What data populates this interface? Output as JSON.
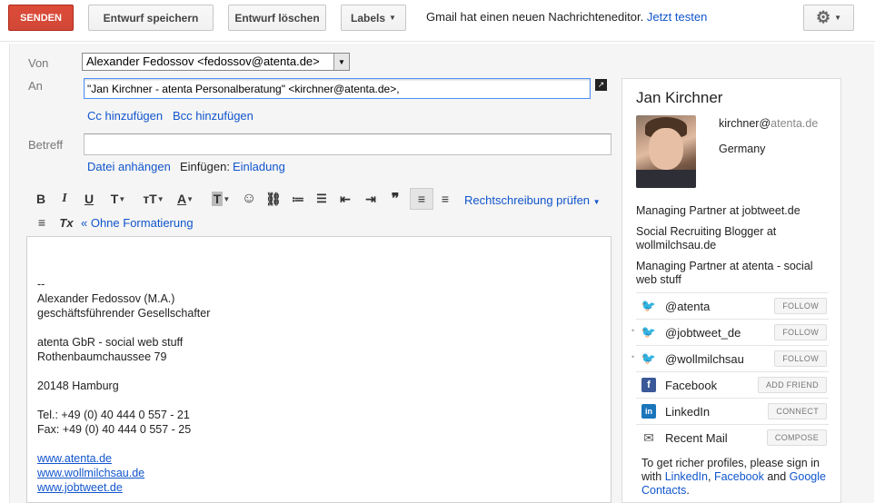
{
  "toolbar": {
    "send": "SENDEN",
    "save_draft": "Entwurf speichern",
    "delete_draft": "Entwurf löschen",
    "labels": "Labels",
    "notice_text": "Gmail hat einen neuen Nachrichteneditor.",
    "notice_link": "Jetzt testen"
  },
  "fields": {
    "from_label": "Von",
    "from_value": "Alexander Fedossov <fedossov@atenta.de>",
    "to_label": "An",
    "to_value": "\"Jan Kirchner - atenta Personalberatung\" <kirchner@atenta.de>,",
    "cc": "Cc hinzufügen",
    "bcc": "Bcc hinzufügen",
    "subject_label": "Betreff",
    "subject_value": "",
    "attach": "Datei anhängen",
    "insert_label": "Einfügen:",
    "insert_invite": "Einladung"
  },
  "format_toolbar": {
    "bold": "B",
    "italic": "I",
    "underline": "U",
    "font": "T",
    "size": "тT",
    "text_color": "A",
    "bg_color": "T",
    "emoji": "☺",
    "link": "⛓",
    "numbered_list": "≔",
    "bullet_list": "☰",
    "indent_less": "⇤",
    "indent_more": "⇥",
    "quote": "❞",
    "align_left": "≡",
    "align_center": "≡",
    "align_right": "≡",
    "clear_format": "Tx",
    "spellcheck": "Rechtschreibung prüfen",
    "plain_text": "« Ohne Formatierung"
  },
  "body": {
    "lines": [
      "--",
      "Alexander Fedossov (M.A.)",
      "geschäftsführender Gesellschafter",
      "",
      "atenta GbR - social web stuff",
      "Rothenbaumchaussee 79",
      "",
      "20148 Hamburg",
      "",
      "Tel.: +49 (0) 40 444 0 557 - 21",
      "Fax: +49 (0) 40 444 0 557 - 25",
      ""
    ],
    "links": [
      "www.atenta.de",
      "www.wollmilchsau.de",
      "www.jobtweet.de"
    ]
  },
  "contact": {
    "name": "Jan Kirchner",
    "email_user": "kirchner@",
    "email_domain": "atenta.de",
    "country": "Germany",
    "info": [
      "Managing Partner at jobtweet.de",
      "Social Recruiting Blogger at wollmilchsau.de",
      "Managing Partner at atenta - social web stuff"
    ],
    "social": [
      {
        "icon": "twitter-icon",
        "name": "@atenta",
        "action": "FOLLOW"
      },
      {
        "icon": "twitter-icon",
        "name": "@jobtweet_de",
        "action": "FOLLOW"
      },
      {
        "icon": "twitter-icon",
        "name": "@wollmilchsau",
        "action": "FOLLOW"
      },
      {
        "icon": "facebook-icon",
        "name": "Facebook",
        "action": "ADD FRIEND"
      },
      {
        "icon": "linkedin-icon",
        "name": "LinkedIn",
        "action": "CONNECT"
      },
      {
        "icon": "mail-icon",
        "name": "Recent Mail",
        "action": "COMPOSE"
      }
    ],
    "signin_text": "To get richer profiles, please sign in with",
    "signin_linkedin": "LinkedIn",
    "signin_facebook": "Facebook",
    "signin_and": "and",
    "signin_google": "Google Contacts",
    "colors": {
      "link": "#1155cc",
      "send": "#d14836",
      "twitter": "#2aa3e0",
      "facebook": "#3b5998",
      "linkedin": "#1b75bb"
    }
  }
}
